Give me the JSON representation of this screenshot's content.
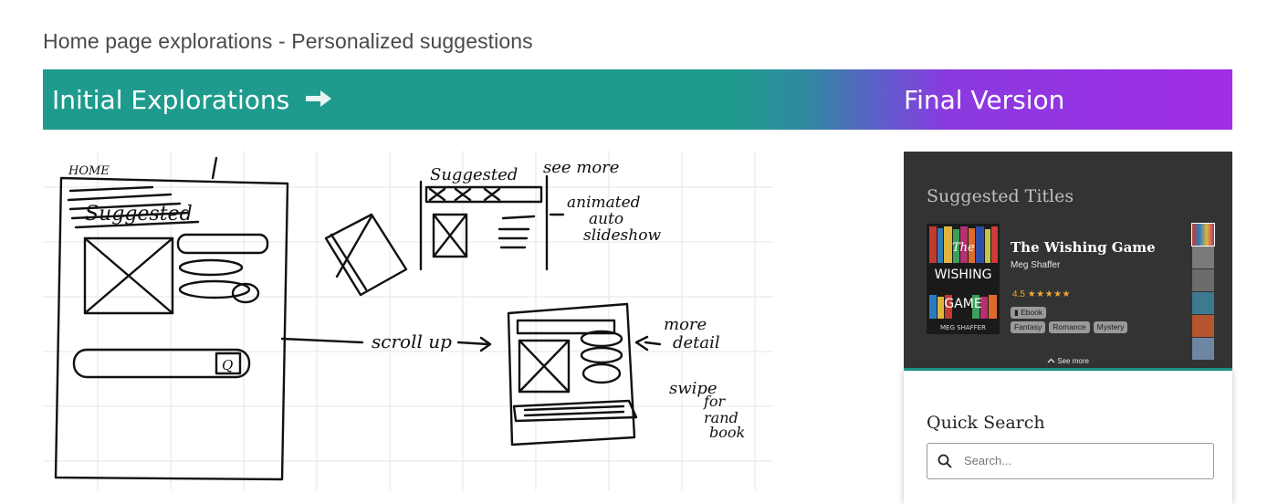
{
  "page": {
    "title": "Home page explorations - Personalized suggestions"
  },
  "banner": {
    "left_label": "Initial Explorations",
    "arrow_icon": "right-arrow-icon",
    "right_label": "Final Version",
    "gradient_start": "#1f9b8e",
    "gradient_end": "#a22de6"
  },
  "sketch": {
    "annotations": {
      "home": "HOME",
      "suggested": "Suggested",
      "see_more": "see more",
      "animated": "animated",
      "auto": "auto",
      "slideshow": "slideshow",
      "scroll_up": "scroll up",
      "more": "more",
      "detail": "detail",
      "swipe": "swipe",
      "for": "for",
      "rand": "rand",
      "book": "book",
      "search_label": "Q"
    }
  },
  "final": {
    "suggested_heading": "Suggested Titles",
    "book": {
      "title": "The Wishing Game",
      "author": "Meg Shaffer",
      "rating": "4.5",
      "stars": "★★★★★",
      "format": "Ebook",
      "genres": [
        "Fantasy",
        "Romance",
        "Mystery"
      ],
      "cover_lines": [
        "The",
        "WISHING",
        "GAME",
        "MEG SHAFFER"
      ]
    },
    "see_more": "See more",
    "quick_search": {
      "heading": "Quick Search",
      "placeholder": "Search..."
    },
    "accent_color": "#1f9b8e"
  }
}
